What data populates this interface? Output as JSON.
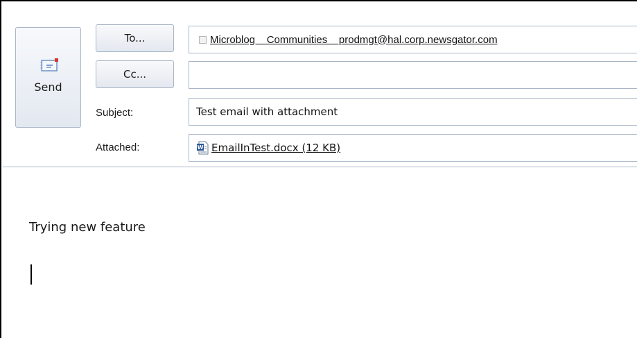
{
  "send": {
    "label": "Send",
    "icon": "envelope-send-icon"
  },
  "address": {
    "to_label": "To...",
    "cc_label": "Cc...",
    "to_recipients": [
      {
        "name": "Microblog    Communities    prodmgt@hal.corp.newsgator.com"
      }
    ],
    "cc_value": ""
  },
  "subject": {
    "label": "Subject:",
    "value": "Test email with attachment"
  },
  "attached": {
    "label": "Attached:",
    "file": "EmailInTest.docx (12 KB)",
    "icon": "word-document-icon"
  },
  "message": {
    "body": "Trying new feature"
  },
  "colors": {
    "border": "#a9b5c6",
    "button_top": "#f7f9fc",
    "button_bottom": "#e3e8f0",
    "word_blue": "#2b5797"
  }
}
